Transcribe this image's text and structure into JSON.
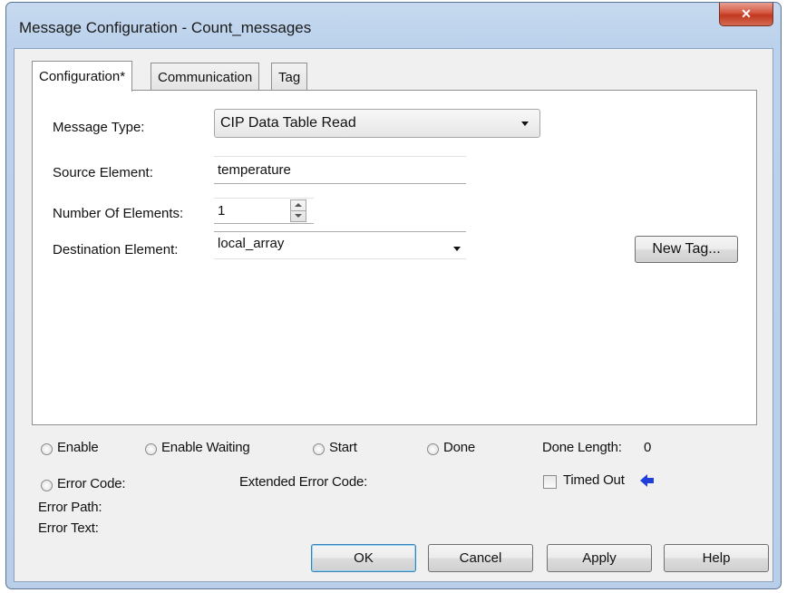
{
  "window": {
    "title": "Message Configuration - Count_messages",
    "close_glyph": "✕"
  },
  "tabs": [
    {
      "label": "Configuration*",
      "active": true
    },
    {
      "label": "Communication",
      "active": false
    },
    {
      "label": "Tag",
      "active": false
    }
  ],
  "config": {
    "message_type_label": "Message Type:",
    "message_type_value": "CIP Data Table Read",
    "source_element_label": "Source Element:",
    "source_element_value": "temperature",
    "number_of_elements_label": "Number Of Elements:",
    "number_of_elements_value": "1",
    "destination_element_label": "Destination Element:",
    "destination_element_value": "local_array",
    "new_tag_button": "New Tag..."
  },
  "status": {
    "enable": "Enable",
    "enable_waiting": "Enable Waiting",
    "start": "Start",
    "done": "Done",
    "done_length_label": "Done Length:",
    "done_length_value": "0",
    "error_code": "Error Code:",
    "extended_error_code": "Extended Error Code:",
    "timed_out": "Timed Out",
    "error_path": "Error Path:",
    "error_text": "Error Text:"
  },
  "buttons": {
    "ok": "OK",
    "cancel": "Cancel",
    "apply": "Apply",
    "help": "Help"
  },
  "colors": {
    "accent_arrow": "#1f3fd8"
  }
}
